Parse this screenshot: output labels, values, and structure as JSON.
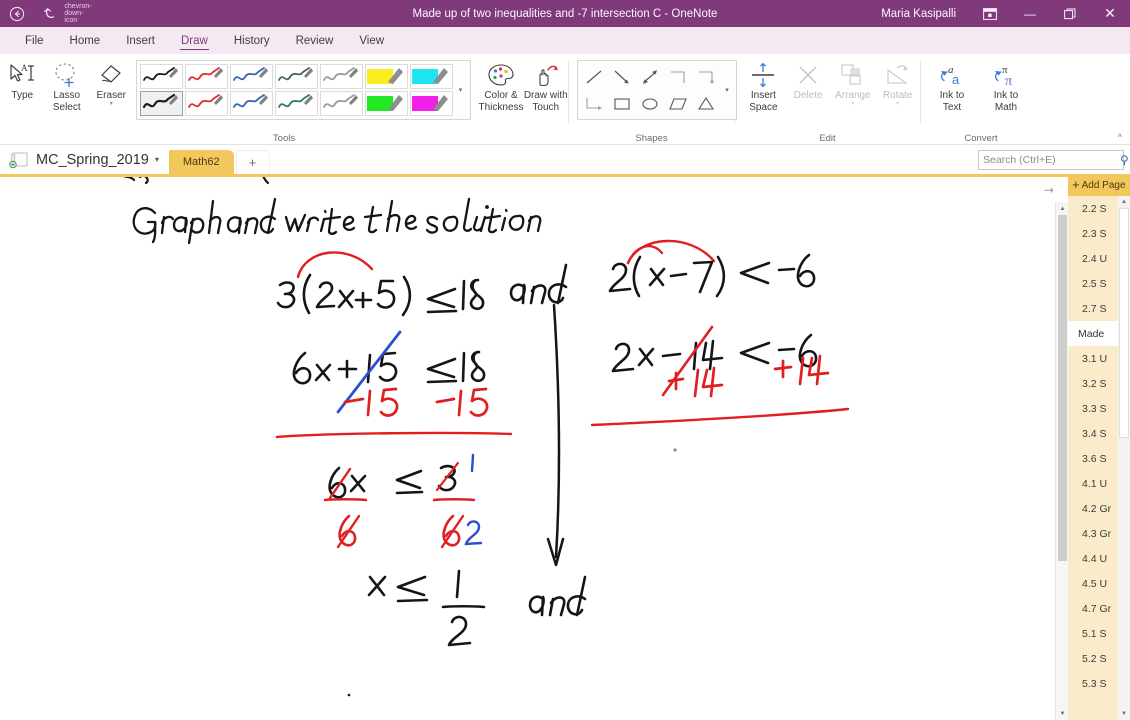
{
  "titlebar": {
    "back_icon": "back-arrow-icon",
    "undo_icon": "undo-icon",
    "qat_caret": "chevron-down-icon",
    "title": "Made up of two inequalities  and -7 intersection C  -  OneNote",
    "user": "Maria Kasipalli",
    "ribbon_options_icon": "ribbon-display-options-icon",
    "minimize": "—",
    "restore": "❐",
    "close": "✕"
  },
  "menubar": {
    "items": [
      {
        "label": "File",
        "active": false
      },
      {
        "label": "Home",
        "active": false
      },
      {
        "label": "Insert",
        "active": false
      },
      {
        "label": "Draw",
        "active": true
      },
      {
        "label": "History",
        "active": false
      },
      {
        "label": "Review",
        "active": false
      },
      {
        "label": "View",
        "active": false
      }
    ]
  },
  "ribbon": {
    "groups": {
      "tools": "Tools",
      "shapes": "Shapes",
      "edit": "Edit",
      "convert": "Convert"
    },
    "collapse_icon": "chevron-up-icon",
    "tools": {
      "type": {
        "line1": "Type",
        "line2": "",
        "icon": "type-cursor-icon"
      },
      "lasso": {
        "line1": "Lasso",
        "line2": "Select",
        "icon": "lasso-select-icon"
      },
      "eraser": {
        "line1": "Eraser",
        "line2": "",
        "icon": "eraser-icon",
        "dropdown": "▾"
      },
      "color_thickness": {
        "line1": "Color &",
        "line2": "Thickness",
        "icon": "color-palette-icon"
      },
      "draw_with_touch": {
        "line1": "Draw with",
        "line2": "Touch",
        "icon": "touch-draw-icon"
      },
      "gallery_caret": "▾",
      "pens": [
        {
          "name": "black-pen",
          "color": "#1d1d1d",
          "type": "pen",
          "selected": false
        },
        {
          "name": "red-pen",
          "color": "#e03030",
          "type": "pen",
          "selected": false
        },
        {
          "name": "blue-pen",
          "color": "#3a62b5",
          "type": "pen",
          "selected": false
        },
        {
          "name": "dark-green-pen",
          "color": "#3f6b55",
          "type": "pen",
          "selected": false
        },
        {
          "name": "gray-pen",
          "color": "#9a9a9a",
          "type": "pen",
          "selected": false
        },
        {
          "name": "yellow-highlighter",
          "color": "#fbee20",
          "type": "highlighter",
          "selected": false
        },
        {
          "name": "cyan-highlighter",
          "color": "#20e4ee",
          "type": "highlighter",
          "selected": false
        },
        {
          "name": "black-pen-thin",
          "color": "#1d1d1d",
          "type": "pen",
          "selected": true
        },
        {
          "name": "red-pen-thin",
          "color": "#e03030",
          "type": "pen",
          "selected": false
        },
        {
          "name": "blue-pen-thin",
          "color": "#3a62b5",
          "type": "pen",
          "selected": false
        },
        {
          "name": "green-pen-thin",
          "color": "#2f7d53",
          "type": "pen",
          "selected": false
        },
        {
          "name": "gray-pen-thin",
          "color": "#9a9a9a",
          "type": "pen",
          "selected": false
        },
        {
          "name": "green-highlighter",
          "color": "#22e822",
          "type": "highlighter",
          "selected": false
        },
        {
          "name": "magenta-highlighter",
          "color": "#f020e8",
          "type": "highlighter",
          "selected": false
        }
      ]
    },
    "shapes": {
      "items": [
        "line-shape",
        "arrow-shape",
        "double-arrow-shape",
        "elbow-connector-shape",
        "elbow-arrow-shape",
        "elbow-down-shape",
        "rectangle-shape",
        "ellipse-shape",
        "parallelogram-shape",
        "triangle-shape"
      ],
      "caret": "▾"
    },
    "edit": {
      "insert_space": {
        "line1": "Insert",
        "line2": "Space",
        "icon": "insert-space-icon",
        "disabled": false
      },
      "delete": {
        "line1": "Delete",
        "line2": "",
        "icon": "delete-x-icon",
        "disabled": true
      },
      "arrange": {
        "line1": "Arrange",
        "line2": "",
        "icon": "arrange-icon",
        "disabled": true,
        "dropdown": "▾"
      },
      "rotate": {
        "line1": "Rotate",
        "line2": "",
        "icon": "rotate-icon",
        "disabled": true,
        "dropdown": "▾"
      }
    },
    "convert": {
      "ink_to_text": {
        "line1": "Ink to",
        "line2": "Text",
        "icon": "ink-to-text-icon"
      },
      "ink_to_math": {
        "line1": "Ink to",
        "line2": "Math",
        "icon": "ink-to-math-icon"
      }
    }
  },
  "notebook": {
    "name": "MC_Spring_2019",
    "caret": "▾",
    "icon": "notebook-icon",
    "section_tab": "Math62",
    "add_section": "+"
  },
  "search": {
    "placeholder": "Search (Ctrl+E)",
    "icon": "search-icon",
    "caret": "▾"
  },
  "pagelist": {
    "add_page": "Add Page",
    "add_page_plus": "+",
    "scroll_up": "▲",
    "scroll_down": "▼",
    "items": [
      {
        "label": "2.2 S",
        "selected": false
      },
      {
        "label": "2.3 S",
        "selected": false
      },
      {
        "label": "2.4 U",
        "selected": false
      },
      {
        "label": "2.5 S",
        "selected": false
      },
      {
        "label": "2.7 S",
        "selected": false
      },
      {
        "label": "Made",
        "selected": true
      },
      {
        "label": "3.1 U",
        "selected": false
      },
      {
        "label": "3.2 S",
        "selected": false
      },
      {
        "label": "3.3 S",
        "selected": false
      },
      {
        "label": "3.4 S",
        "selected": false
      },
      {
        "label": "3.6 S",
        "selected": false
      },
      {
        "label": "4.1 U",
        "selected": false
      },
      {
        "label": "4.2 Gr",
        "selected": false
      },
      {
        "label": "4.3 Gr",
        "selected": false
      },
      {
        "label": "4.4 U",
        "selected": false
      },
      {
        "label": "4.5 U",
        "selected": false
      },
      {
        "label": "4.7 Gr",
        "selected": false
      },
      {
        "label": "5.1 S",
        "selected": false
      },
      {
        "label": "5.2 S",
        "selected": false
      },
      {
        "label": "5.3 S",
        "selected": false
      }
    ]
  },
  "canvas": {
    "expand_icon": "expand-page-icon",
    "scroll_up": "▲",
    "scroll_down": "▼",
    "ink": {
      "heading": "Graph and write the solution.",
      "left_column": {
        "step1": "3 ( 2x + 5 )  ≤ 18",
        "step2": "6x + 15   ≤ 18",
        "step2_sub_left": "−15",
        "step2_sub_right": "−15",
        "step3_num_left": "6x",
        "step3_den_left": "6",
        "step3_rel": "≤",
        "step3_num_right": "3",
        "step3_den_right": "6",
        "step3_cancel_num": "1",
        "step3_cancel_den": "2",
        "answer_var": "x",
        "answer_rel": "≤",
        "answer_num": "1",
        "answer_den": "2"
      },
      "connector_and_top": "and",
      "connector_and_bottom": "and",
      "right_column": {
        "step1": "2 ( x − 7 )  < − 6",
        "step2": "2x − 14   < − 6",
        "step2_add_left": "+14",
        "step2_add_right": "+ 14"
      }
    }
  },
  "colors": {
    "brand_purple": "#80397b",
    "menu_bg": "#f4e8f3",
    "section_gold": "#f2c75c",
    "pagelist_bg": "#faeccb",
    "ink_black": "#151515",
    "ink_red": "#e02020",
    "ink_blue": "#2b4fcf"
  }
}
